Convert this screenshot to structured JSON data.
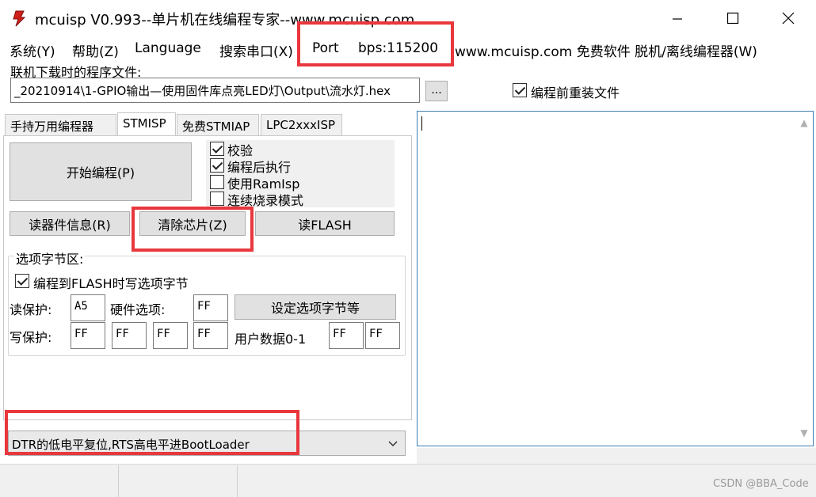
{
  "titlebar": {
    "title": "mcuisp V0.993--单片机在线编程专家--www.mcuisp.com"
  },
  "menu": {
    "system": "系统(Y)",
    "help": "帮助(Z)",
    "language": "Language",
    "search_port": "搜索串口(X)",
    "port": "Port",
    "bps": "bps:115200",
    "site": "www.mcuisp.com 免费软件 脱机/离线编程器(W)"
  },
  "file": {
    "label": "联机下载时的程序文件:",
    "path": "_20210914\\1-GPIO输出—使用固件库点亮LED灯\\Output\\流水灯.hex",
    "browse": "...",
    "reload_label": "编程前重装文件"
  },
  "tabs": [
    "手持万用编程器",
    "STMISP",
    "免费STMIAP",
    "LPC2xxxISP"
  ],
  "stmisp": {
    "start_program": "开始编程(P)",
    "verify": "校验",
    "run_after": "编程后执行",
    "use_ramisp": "使用RamIsp",
    "continuous": "连续烧录模式",
    "read_info": "读器件信息(R)",
    "erase_chip": "清除芯片(Z)",
    "read_flash": "读FLASH"
  },
  "options": {
    "group_title": "选项字节区:",
    "write_on_flash": "编程到FLASH时写选项字节",
    "read_protect_label": "读保护:",
    "read_protect": "A5",
    "hw_option_label": "硬件选项:",
    "hw_option": "FF",
    "set_button": "设定选项字节等",
    "write_protect_label": "写保护:",
    "write_protect": [
      "FF",
      "FF",
      "FF",
      "FF"
    ],
    "user_data_label": "用户数据0-1",
    "user_data": [
      "FF",
      "FF"
    ]
  },
  "boot_mode": {
    "selected": "DTR的低电平复位,RTS高电平进BootLoader"
  },
  "watermark": "CSDN @BBA_Code"
}
